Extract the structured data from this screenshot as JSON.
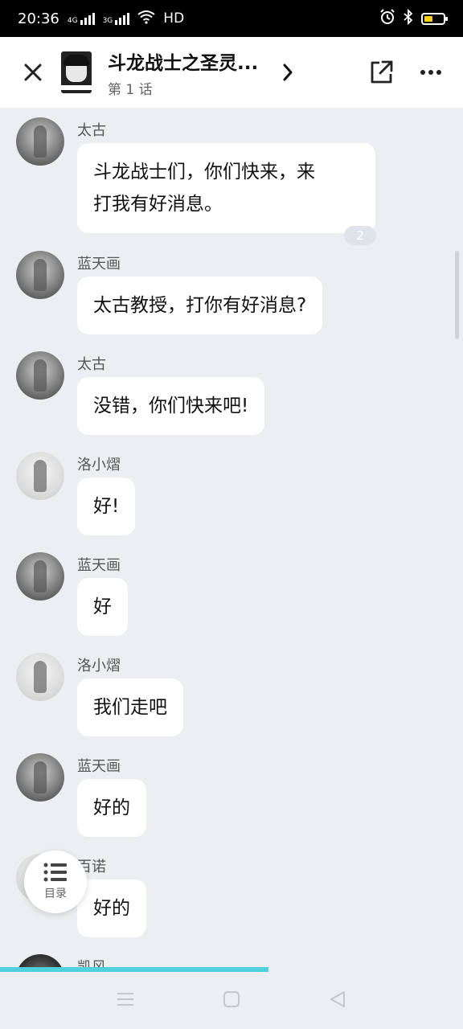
{
  "status": {
    "time": "20:36",
    "net1": "4G",
    "net2": "3G",
    "hd": "HD"
  },
  "header": {
    "title": "斗龙战士之圣灵...",
    "subtitle": "第 1 话"
  },
  "messages": [
    {
      "name": "太古",
      "text": "斗龙战士们，你们快来，来打我有好消息。",
      "line1": "斗龙战士们，你们快来，来",
      "line2": "打我有好消息。",
      "badge": "2",
      "avatar": "taigu-avatar"
    },
    {
      "name": "蓝天画",
      "text": "太古教授，打你有好消息?",
      "avatar": "lantianhua-avatar"
    },
    {
      "name": "太古",
      "text": "没错，你们快来吧!",
      "avatar": "taigu-avatar"
    },
    {
      "name": "洛小熠",
      "text": "好!",
      "avatar": "luoxiaoyi-avatar"
    },
    {
      "name": "蓝天画",
      "text": "好",
      "avatar": "lantianhua-avatar"
    },
    {
      "name": "洛小熠",
      "text": "我们走吧",
      "avatar": "luoxiaoyi-avatar"
    },
    {
      "name": "蓝天画",
      "text": "好的",
      "avatar": "lantianhua-avatar"
    },
    {
      "name": "百诺",
      "text": "好的",
      "avatar": "bainuo-avatar"
    },
    {
      "name": "凯风",
      "text": "",
      "avatar": "kaifeng-avatar"
    }
  ],
  "toc": {
    "label": "目录"
  },
  "reading_progress": 0.58,
  "colors": {
    "accent": "#4fd0dc",
    "background": "#eceef1",
    "bubble": "#ffffff"
  },
  "icons": [
    "close-icon",
    "chevron-right-icon",
    "share-icon",
    "more-icon",
    "list-icon",
    "menu-icon",
    "home-icon",
    "back-icon"
  ]
}
